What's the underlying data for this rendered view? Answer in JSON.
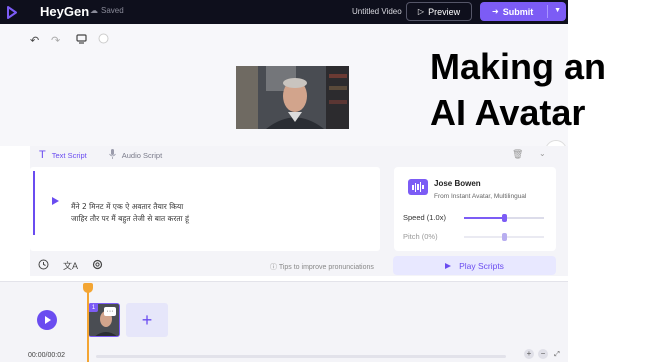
{
  "topbar": {
    "brand": "HeyGen",
    "saved": "Saved",
    "video_title": "Untitled Video",
    "preview_label": "Preview",
    "submit_label": "Submit"
  },
  "overlay": {
    "line1": "Making an",
    "line2": "AI Avatar"
  },
  "script": {
    "tab_text": "Text Script",
    "tab_audio": "Audio Script",
    "line1": "मैंने 2 मिनट में एक ऐ अवतार तैयार किया",
    "line2": "जाहिर तौर पर मैं बहुत तेजी से बात करता हूं",
    "tips": "Tips to improve pronunciations",
    "play_scripts": "Play Scripts"
  },
  "voice": {
    "name": "Jose Bowen",
    "source": "From Instant Avatar, Multilingual",
    "speed_label": "Speed (1.0x)",
    "speed_value": 0.5,
    "pitch_label": "Pitch (0%)",
    "pitch_value": 0.5
  },
  "timeline": {
    "clip_number": "1",
    "clip_menu": "···",
    "add_label": "+",
    "time": "00:00/00:02",
    "zoom_in": "+",
    "zoom_out": "−"
  },
  "colors": {
    "accent": "#7c5cf5",
    "playhead": "#f3a533",
    "topbar": "#0e0f1c"
  }
}
